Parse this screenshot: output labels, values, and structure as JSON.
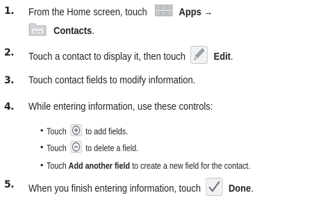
{
  "steps": [
    {
      "number": "1.",
      "text_a": "From the Home screen, touch",
      "apps_label": "Apps",
      "arrow": "→",
      "contacts_label": "Contacts",
      "period": "."
    },
    {
      "number": "2.",
      "text_a": "Touch a contact to display it, then touch",
      "edit_label": "Edit",
      "period": "."
    },
    {
      "number": "3.",
      "text": "Touch contact fields to modify information."
    },
    {
      "number": "4.",
      "text": "While entering information, use these controls:"
    },
    {
      "number": "5.",
      "text_a": "When you finish entering information, touch",
      "done_label": "Done",
      "period": "."
    }
  ],
  "bullets": [
    {
      "dot": "•",
      "text_a": "Touch",
      "text_b": "to add fields."
    },
    {
      "dot": "•",
      "text_a": "Touch",
      "text_b": "to delete a field."
    },
    {
      "dot": "•",
      "text_a": "Touch",
      "bold": "Add another field",
      "text_b": "to create a new field for the contact."
    }
  ],
  "icons": {
    "apps": "apps-grid-icon",
    "contacts": "contacts-app-icon",
    "edit": "pencil-edit-icon",
    "add": "plus-circle-icon",
    "delete": "minus-circle-icon",
    "done": "checkmark-icon"
  }
}
